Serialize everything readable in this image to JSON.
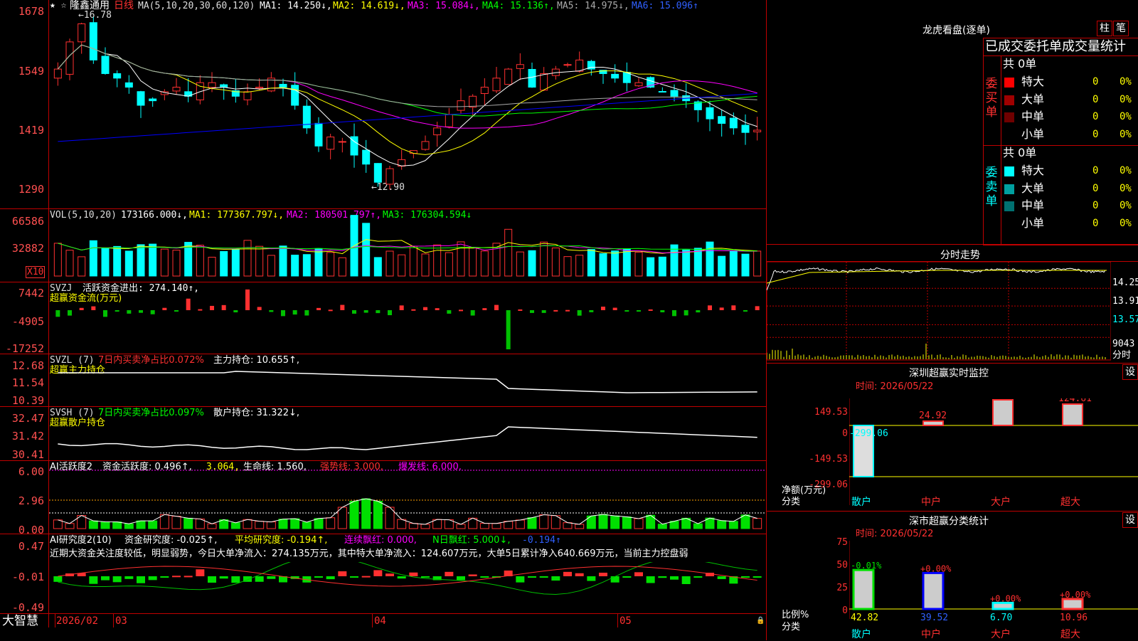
{
  "colors": {
    "up": "#ff3030",
    "down": "#00ffff",
    "frame": "#c00000",
    "ma1": "#ffffff",
    "ma2": "#ffff00",
    "ma3": "#ff00ff",
    "ma4": "#00ff00",
    "ma5": "#aaaaaa",
    "ma6": "#0000ff"
  },
  "main": {
    "stock_name": "隆鑫通用",
    "period": "日线",
    "ma_params": "MA(5,10,20,30,60,120)",
    "ma_items": [
      {
        "text": "MA1: 14.250↓,"
      },
      {
        "text": "MA2: 14.619↓,"
      },
      {
        "text": "MA3: 15.084↓,"
      },
      {
        "text": "MA4: 15.136↑,"
      },
      {
        "text": "MA5: 14.975↓,"
      },
      {
        "text": "MA6: 15.096↑"
      }
    ],
    "y_labels": [
      "1678",
      "1549",
      "1419",
      "1290"
    ],
    "high_mark": "16.78",
    "low_mark": "12.90"
  },
  "vol": {
    "label": "VOL(5,10,20)",
    "value": "173166.000↓,",
    "ma1": "MA1: 177367.797↓,",
    "ma2": "MA2: 180501.797↑,",
    "ma3": "MA3: 176304.594↓",
    "y_labels": [
      "66586",
      "32882"
    ],
    "unit": "X10"
  },
  "svzj": {
    "label": "SVZJ",
    "desc": "活跃资金进出: 274.140↑,",
    "sub": "超赢资金流(万元)",
    "y_labels": [
      "7442",
      "-4905",
      "-17252"
    ]
  },
  "svzl": {
    "label": "SVZL (7)",
    "desc": "7日内买卖净占比0.072%",
    "desc2": "主力持仓: 10.655↑,",
    "sub": "超赢主力持仓",
    "y_labels": [
      "12.68",
      "11.54",
      "10.39"
    ]
  },
  "svsh": {
    "label": "SVSH (7)",
    "desc": "7日内买卖净占比0.097%",
    "desc2": "散户持仓: 31.322↓,",
    "sub": "超赢散户持仓",
    "y_labels": [
      "32.47",
      "31.42",
      "30.41"
    ]
  },
  "ai_active": {
    "label": "AI活跃度2",
    "t1": "资金活跃度: 0.496↑,",
    "t2": "3.064,",
    "t3": "生命线: 1.560,",
    "t4": "强势线: 3.000,",
    "t5": "爆发线: 6.000,",
    "y_labels": [
      "6.00",
      "2.96",
      "0.00"
    ]
  },
  "ai_research": {
    "label": "AI研究度2(10)",
    "t1": "资金研究度: -0.025↑,",
    "t2": "平均研究度: -0.194↑,",
    "t3": "连续飘红: 0.000,",
    "t4": "N日飘红: 5.000↓,",
    "t5": "-0.194↑",
    "comment": "近期大资金关注度较低，明显弱势，今日大单净流入：274.135万元，其中特大单净流入：124.607万元，大单5日累计净入640.669万元，当前主力控盘弱",
    "y_labels": [
      "0.47",
      "-0.01",
      "-0.49"
    ]
  },
  "footer": {
    "brand": "大智慧",
    "dates": [
      "2026/02",
      "03",
      "04",
      "05"
    ]
  },
  "dragon": {
    "title": "龙虎看盘(逐单)",
    "tab1": "柱",
    "tab2": "笔",
    "header": "已成交委托单成交量统计",
    "buy_label": "委买单",
    "sell_label": "委卖单",
    "buy_total": "共 0单",
    "sell_total": "共 0单",
    "buy_rows": [
      {
        "name": "特大",
        "count": "0",
        "pct": "0%",
        "color": "#ff0000"
      },
      {
        "name": "大单",
        "count": "0",
        "pct": "0%",
        "color": "#a00000"
      },
      {
        "name": "中单",
        "count": "0",
        "pct": "0%",
        "color": "#700000"
      },
      {
        "name": "小单",
        "count": "0",
        "pct": "0%",
        "color": ""
      }
    ],
    "sell_rows": [
      {
        "name": "特大",
        "count": "0",
        "pct": "0%",
        "color": "#00ffff"
      },
      {
        "name": "大单",
        "count": "0",
        "pct": "0%",
        "color": "#00a0a0"
      },
      {
        "name": "中单",
        "count": "0",
        "pct": "0%",
        "color": "#007070"
      },
      {
        "name": "小单",
        "count": "0",
        "pct": "0%",
        "color": ""
      }
    ]
  },
  "intraday": {
    "title": "分时走势",
    "labels": [
      "14.25",
      "13.91",
      "13.57"
    ],
    "vol_label": "9043",
    "vol_unit": "分时"
  },
  "monitor": {
    "title": "深圳超赢实时监控",
    "set": "设",
    "time": "时间: 2026/05/22",
    "y_labels": [
      "149.53",
      "0",
      "-149.53",
      "-299.06"
    ],
    "unit": "净额(万元)",
    "axis_name": "分类",
    "bars": [
      {
        "name": "散户",
        "value": -299.06,
        "label": "-299.06"
      },
      {
        "name": "中户",
        "value": 24.92,
        "label": "24.92"
      },
      {
        "name": "大户",
        "value": 149.53,
        "label": "149.53"
      },
      {
        "name": "超大",
        "value": 124.61,
        "label": "124.61"
      }
    ]
  },
  "classify": {
    "title": "深市超赢分类统计",
    "set": "设",
    "time": "时间: 2026/05/22",
    "y_labels": [
      "75",
      "50",
      "25",
      "0"
    ],
    "unit": "比例%",
    "axis_name": "分类",
    "bars": [
      {
        "name": "散户",
        "value": 42.82,
        "label": "42.82",
        "delta": "-0.01%"
      },
      {
        "name": "中户",
        "value": 39.52,
        "label": "39.52",
        "delta": "+0.00%"
      },
      {
        "name": "大户",
        "value": 6.7,
        "label": "6.70",
        "delta": "+0.00%"
      },
      {
        "name": "超大",
        "value": 10.96,
        "label": "10.96",
        "delta": "+0.00%"
      }
    ]
  }
}
